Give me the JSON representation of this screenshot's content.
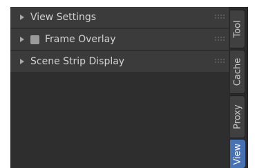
{
  "panels": [
    {
      "label": "View Settings",
      "has_checkbox": false
    },
    {
      "label": "Frame Overlay",
      "has_checkbox": true
    },
    {
      "label": "Scene Strip Display",
      "has_checkbox": false
    }
  ],
  "tabs": [
    {
      "label": "Tool",
      "active": false
    },
    {
      "label": "Cache",
      "active": false
    },
    {
      "label": "Proxy",
      "active": false
    },
    {
      "label": "View",
      "active": true
    }
  ],
  "colors": {
    "panel_bg": "#2e2e2e",
    "header_bg": "#3b3b3b",
    "active_tab": "#4772b3",
    "text": "#d2d2d2"
  }
}
